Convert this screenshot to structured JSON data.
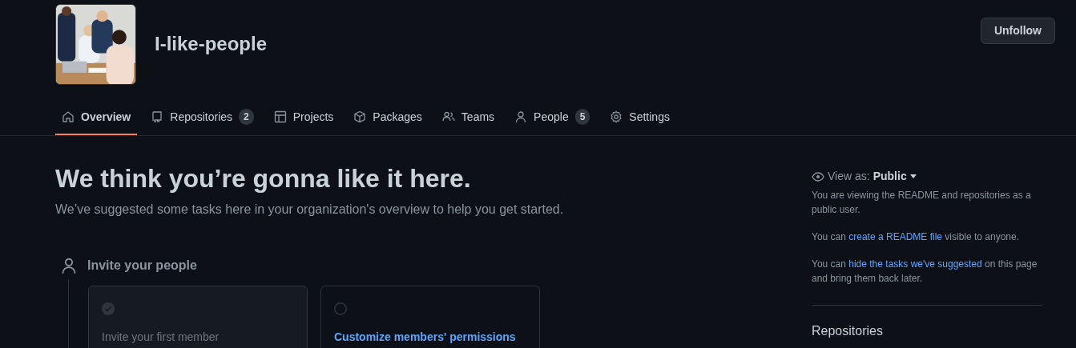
{
  "org": {
    "kind": "picture",
    "name": "I-like-people",
    "follow_button": "Unfollow"
  },
  "tabs": [
    {
      "label": "Overview",
      "kind": "home",
      "selected": true
    },
    {
      "label": "Repositories",
      "kind": "repo",
      "count": "2",
      "selected": false
    },
    {
      "label": "Projects",
      "kind": "table",
      "selected": false
    },
    {
      "label": "Packages",
      "kind": "package",
      "selected": false
    },
    {
      "label": "Teams",
      "kind": "people",
      "selected": false
    },
    {
      "label": "People",
      "kind": "person",
      "count": "5",
      "selected": false
    },
    {
      "label": "Settings",
      "kind": "gear",
      "selected": false
    }
  ],
  "intro": {
    "heading": "We think you’re gonna like it here.",
    "subtitle": "We’ve suggested some tasks here in your organization's overview to help you get started."
  },
  "section": {
    "title": "Invite your people",
    "tasks": [
      {
        "title": "Invite your first member",
        "done": true
      },
      {
        "title": "Customize members' permissions",
        "done": false
      }
    ]
  },
  "sidebar": {
    "view_as_label": "View as:",
    "view_as_value": "Public",
    "paragraphs": [
      {
        "before": "You are viewing the README and repositories as a public user."
      },
      {
        "before": "You can ",
        "link": "create a README file",
        "after": " visible to anyone."
      },
      {
        "before": "You can ",
        "link": "hide the tasks we've suggested",
        "after": " on this page and bring them back later."
      }
    ],
    "repositories_heading": "Repositories"
  }
}
